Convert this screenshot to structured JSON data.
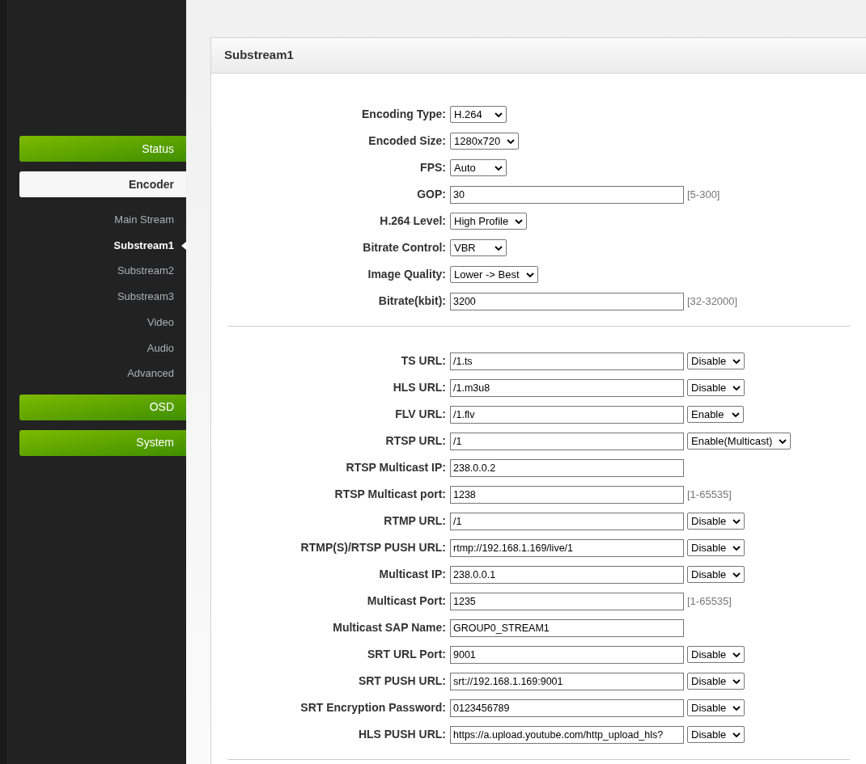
{
  "sidebar": {
    "items": [
      {
        "kind": "button",
        "label": "Status",
        "selected": false
      },
      {
        "kind": "button",
        "label": "Encoder",
        "selected": true
      },
      {
        "kind": "subitem",
        "label": "Main Stream",
        "selected": false
      },
      {
        "kind": "subitem",
        "label": "Substream1",
        "selected": true
      },
      {
        "kind": "subitem",
        "label": "Substream2",
        "selected": false
      },
      {
        "kind": "subitem",
        "label": "Substream3",
        "selected": false
      },
      {
        "kind": "subitem",
        "label": "Video",
        "selected": false
      },
      {
        "kind": "subitem",
        "label": "Audio",
        "selected": false
      },
      {
        "kind": "subitem",
        "label": "Advanced",
        "selected": false
      },
      {
        "kind": "button",
        "label": "OSD",
        "selected": false
      },
      {
        "kind": "button",
        "label": "System",
        "selected": false
      }
    ]
  },
  "panel": {
    "title": "Substream1",
    "sections": [
      {
        "rows": [
          {
            "label": "Encoding Type:",
            "kind": "select",
            "value": "H.264"
          },
          {
            "label": "Encoded Size:",
            "kind": "select",
            "value": "1280x720"
          },
          {
            "label": "FPS:",
            "kind": "select",
            "value": "Auto"
          },
          {
            "label": "GOP:",
            "kind": "input",
            "value": "30",
            "hint": "[5-300]"
          },
          {
            "label": "H.264 Level:",
            "kind": "select",
            "value": "High Profile"
          },
          {
            "label": "Bitrate Control:",
            "kind": "select",
            "value": "VBR"
          },
          {
            "label": "Image Quality:",
            "kind": "select",
            "value": "Lower -> Best"
          },
          {
            "label": "Bitrate(kbit):",
            "kind": "input",
            "value": "3200",
            "hint": "[32-32000]"
          }
        ]
      },
      {
        "rows": [
          {
            "label": "TS URL:",
            "kind": "input",
            "value": "/1.ts",
            "option": "Disable"
          },
          {
            "label": "HLS URL:",
            "kind": "input",
            "value": "/1.m3u8",
            "option": "Disable"
          },
          {
            "label": "FLV URL:",
            "kind": "input",
            "value": "/1.flv",
            "option": "Enable"
          },
          {
            "label": "RTSP URL:",
            "kind": "input",
            "value": "/1",
            "option": "Enable(Multicast)"
          },
          {
            "label": "RTSP Multicast IP:",
            "kind": "input",
            "value": "238.0.0.2"
          },
          {
            "label": "RTSP Multicast port:",
            "kind": "input",
            "value": "1238",
            "hint": "[1-65535]"
          },
          {
            "label": "RTMP URL:",
            "kind": "input",
            "value": "/1",
            "option": "Disable"
          },
          {
            "label": "RTMP(S)/RTSP PUSH URL:",
            "kind": "input",
            "value": "rtmp://192.168.1.169/live/1",
            "option": "Disable"
          },
          {
            "label": "Multicast IP:",
            "kind": "input",
            "value": "238.0.0.1",
            "option": "Disable"
          },
          {
            "label": "Multicast Port:",
            "kind": "input",
            "value": "1235",
            "hint": "[1-65535]"
          },
          {
            "label": "Multicast SAP Name:",
            "kind": "input",
            "value": "GROUP0_STREAM1"
          },
          {
            "label": "SRT URL Port:",
            "kind": "input",
            "value": "9001",
            "option": "Disable"
          },
          {
            "label": "SRT PUSH URL:",
            "kind": "input",
            "value": "srt://192.168.1.169:9001",
            "option": "Disable"
          },
          {
            "label": "SRT Encryption Password:",
            "kind": "input",
            "value": "0123456789",
            "option": "Disable"
          },
          {
            "label": "HLS PUSH URL:",
            "kind": "input",
            "value": "https://a.upload.youtube.com/http_upload_hls?",
            "option": "Disable"
          }
        ]
      }
    ]
  }
}
